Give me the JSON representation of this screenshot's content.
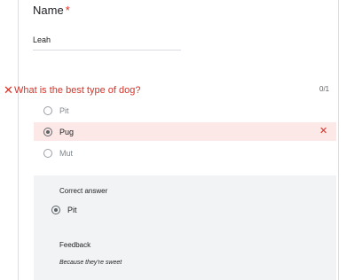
{
  "name_question": {
    "label": "Name",
    "required_mark": "*",
    "value": "Leah"
  },
  "dog_question": {
    "status_icon": "close-icon",
    "title": "What is the best type of dog?",
    "score": "0/1",
    "options": [
      {
        "label": "Pit",
        "selected": false
      },
      {
        "label": "Pug",
        "selected": true,
        "incorrect": true
      },
      {
        "label": "Mut",
        "selected": false
      }
    ],
    "correct_answer": {
      "heading": "Correct answer",
      "option": "Pit"
    },
    "feedback": {
      "heading": "Feedback",
      "text": "Because they're sweet"
    }
  },
  "colors": {
    "error": "#d93025",
    "selected_bg": "#fce8e6",
    "answer_bg": "#f1f3f4"
  }
}
